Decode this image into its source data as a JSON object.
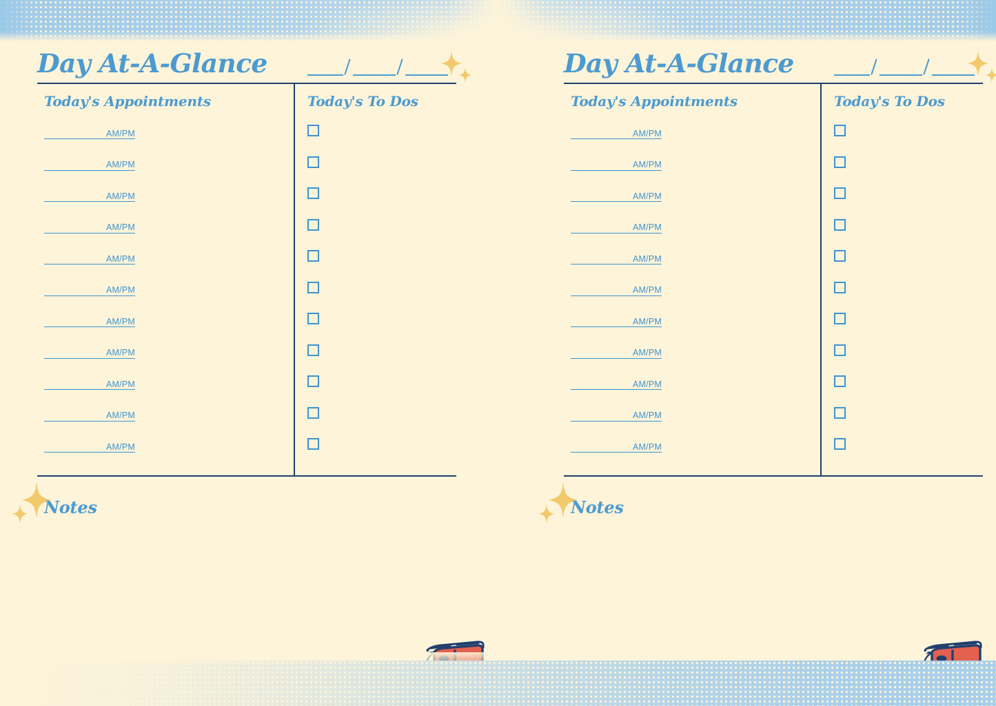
{
  "document": {
    "type": "daily planner spread",
    "page_count": 2,
    "background_color": "#FDF4DA",
    "accent_blue": "#4C9AD0",
    "line_blue": "#3E93CE",
    "rule_navy": "#1E3F6B",
    "sparkle_gold": "#F2C96B",
    "band_blue": "#A9CFEA",
    "toaster_red": "#E4604F",
    "toaster_navy": "#22406E"
  },
  "page": {
    "title": "Day At-A-Glance",
    "date_blanks": [
      "",
      "",
      ""
    ],
    "date_separator": "/",
    "columns": {
      "appointments_heading": "Today's Appointments",
      "todos_heading": "Today's To Dos"
    },
    "appointment_rows": [
      {
        "time": "",
        "suffix": "AM/PM"
      },
      {
        "time": "",
        "suffix": "AM/PM"
      },
      {
        "time": "",
        "suffix": "AM/PM"
      },
      {
        "time": "",
        "suffix": "AM/PM"
      },
      {
        "time": "",
        "suffix": "AM/PM"
      },
      {
        "time": "",
        "suffix": "AM/PM"
      },
      {
        "time": "",
        "suffix": "AM/PM"
      },
      {
        "time": "",
        "suffix": "AM/PM"
      },
      {
        "time": "",
        "suffix": "AM/PM"
      },
      {
        "time": "",
        "suffix": "AM/PM"
      },
      {
        "time": "",
        "suffix": "AM/PM"
      }
    ],
    "todo_rows": [
      {
        "checked": false,
        "text": ""
      },
      {
        "checked": false,
        "text": ""
      },
      {
        "checked": false,
        "text": ""
      },
      {
        "checked": false,
        "text": ""
      },
      {
        "checked": false,
        "text": ""
      },
      {
        "checked": false,
        "text": ""
      },
      {
        "checked": false,
        "text": ""
      },
      {
        "checked": false,
        "text": ""
      },
      {
        "checked": false,
        "text": ""
      },
      {
        "checked": false,
        "text": ""
      },
      {
        "checked": false,
        "text": ""
      }
    ],
    "notes_heading": "Notes",
    "notes_value": ""
  },
  "decorations": {
    "sparkle_header_large": "sparkle-icon",
    "sparkle_header_small": "sparkle-icon",
    "sparkle_notes_large": "sparkle-icon",
    "sparkle_notes_small": "sparkle-icon",
    "toaster": "toaster-illustration",
    "top_band": "halftone-band",
    "bottom_band": "halftone-band"
  }
}
